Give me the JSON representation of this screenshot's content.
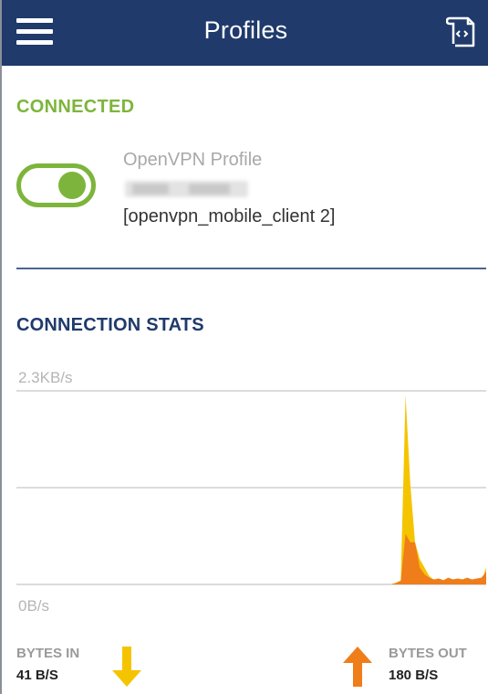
{
  "appbar": {
    "title": "Profiles",
    "icons": {
      "menu": "hamburger-menu-icon",
      "import": "import-profile-icon"
    },
    "color": "#1f3a6b"
  },
  "connection": {
    "status": "CONNECTED",
    "status_color": "#7db53c",
    "toggle_on": true,
    "profile_type": "OpenVPN Profile",
    "profile_name": "[openvpn_mobile_client 2]"
  },
  "stats": {
    "title": "CONNECTION STATS",
    "bytes_in_label": "BYTES IN",
    "bytes_in_value": "41 B/S",
    "bytes_out_label": "BYTES OUT",
    "bytes_out_value": "180 B/S",
    "in_color": "#f5c400",
    "out_color": "#ef7d1a"
  },
  "chart_data": {
    "type": "area",
    "ylabel_top": "2.3KB/s",
    "ylabel_bottom": "0B/s",
    "ylim": [
      0,
      2.3
    ],
    "unit": "KB/s",
    "grid": true,
    "series": [
      {
        "color": "#f5c400",
        "values": [
          0,
          0,
          0,
          0,
          0,
          0,
          0,
          0,
          0,
          0,
          0,
          0,
          0,
          0,
          0,
          0,
          0,
          0,
          0,
          0,
          0,
          0,
          0,
          0,
          0,
          0,
          0,
          0,
          0,
          0,
          0,
          0,
          0,
          0,
          0,
          0,
          0,
          0,
          0,
          0,
          0,
          0,
          0,
          0,
          0,
          0,
          0,
          0,
          0,
          0,
          0,
          0,
          0,
          0,
          0,
          0,
          0,
          0,
          0,
          0,
          0,
          0,
          0,
          0,
          0,
          0,
          0,
          0,
          0,
          0,
          0,
          0,
          0,
          0,
          0,
          0,
          0,
          0,
          0,
          0,
          0.02,
          0.05,
          2.25,
          1.2,
          0.5,
          0.3,
          0.2,
          0.1,
          0.05,
          0.04,
          0.05,
          0.04,
          0.05,
          0.04,
          0.04,
          0.05,
          0.04,
          0.05,
          0.04,
          0.2
        ]
      },
      {
        "color": "#ef7d1a",
        "values": [
          0,
          0,
          0,
          0,
          0,
          0,
          0,
          0,
          0,
          0,
          0,
          0,
          0,
          0,
          0,
          0,
          0,
          0,
          0,
          0,
          0,
          0,
          0,
          0,
          0,
          0,
          0,
          0,
          0,
          0,
          0,
          0,
          0,
          0,
          0,
          0,
          0,
          0,
          0,
          0,
          0,
          0,
          0,
          0,
          0,
          0,
          0,
          0,
          0,
          0,
          0,
          0,
          0,
          0,
          0,
          0,
          0,
          0,
          0,
          0,
          0,
          0,
          0,
          0,
          0,
          0,
          0,
          0,
          0,
          0,
          0,
          0,
          0,
          0,
          0,
          0,
          0,
          0,
          0,
          0,
          0.02,
          0.04,
          0.6,
          0.5,
          0.5,
          0.2,
          0.12,
          0.08,
          0.06,
          0.07,
          0.05,
          0.08,
          0.06,
          0.07,
          0.06,
          0.08,
          0.06,
          0.07,
          0.08,
          0.15
        ]
      }
    ]
  }
}
